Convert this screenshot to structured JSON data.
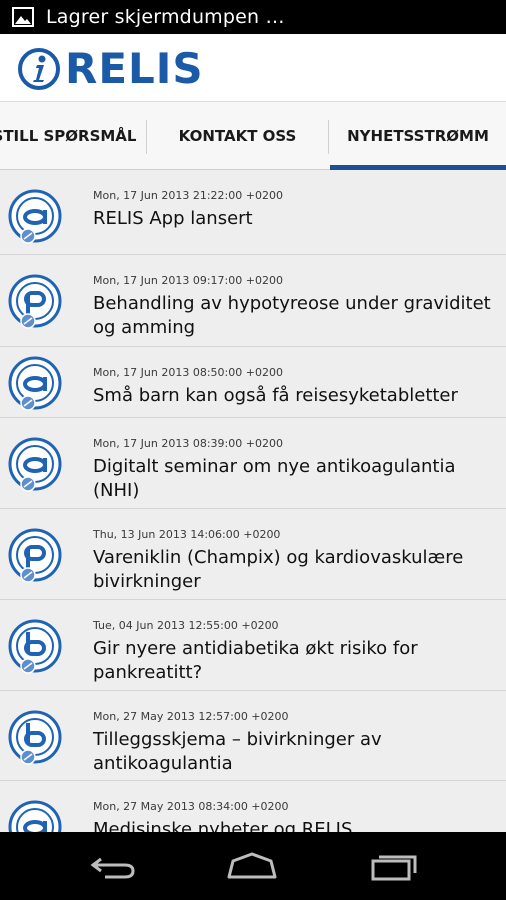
{
  "status_bar": {
    "notification_icon": "image-icon",
    "text": "Lagrer skjermdumpen …"
  },
  "app": {
    "logo_text": "RELIS",
    "logo_icon": "info-i-icon",
    "brand_color": "#1a5aa6"
  },
  "tabs": [
    {
      "label": "STILL SPØRSMÅL",
      "selected": false
    },
    {
      "label": "KONTAKT OSS",
      "selected": false
    },
    {
      "label": "NYHETSSTRØMM",
      "selected": true
    }
  ],
  "news": [
    {
      "icon": "a",
      "date": "Mon, 17 Jun 2013 21:22:00 +0200",
      "title": "RELIS App lansert"
    },
    {
      "icon": "p",
      "date": "Mon, 17 Jun 2013 09:17:00 +0200",
      "title": "Behandling av hypotyreose under graviditet og amming"
    },
    {
      "icon": "a",
      "date": "Mon, 17 Jun 2013 08:50:00 +0200",
      "title": "Små barn kan også få reisesyketabletter"
    },
    {
      "icon": "a",
      "date": "Mon, 17 Jun 2013 08:39:00 +0200",
      "title": "Digitalt seminar om nye antikoagulantia (NHI)"
    },
    {
      "icon": "p",
      "date": "Thu, 13 Jun 2013 14:06:00 +0200",
      "title": "Vareniklin (Champix) og kardiovaskulære bivirkninger"
    },
    {
      "icon": "b",
      "date": "Tue, 04 Jun 2013 12:55:00 +0200",
      "title": "Gir nyere antidiabetika økt risiko for pankreatitt?"
    },
    {
      "icon": "b",
      "date": "Mon, 27 May 2013 12:57:00 +0200",
      "title": "Tilleggsskjema – bivirkninger av antikoagulantia"
    },
    {
      "icon": "a",
      "date": "Mon, 27 May 2013 08:34:00 +0200",
      "title": "Medisinske nyheter og RELIS"
    }
  ],
  "nav_bar": {
    "back": "back-icon",
    "home": "home-icon",
    "recents": "recent-apps-icon"
  }
}
